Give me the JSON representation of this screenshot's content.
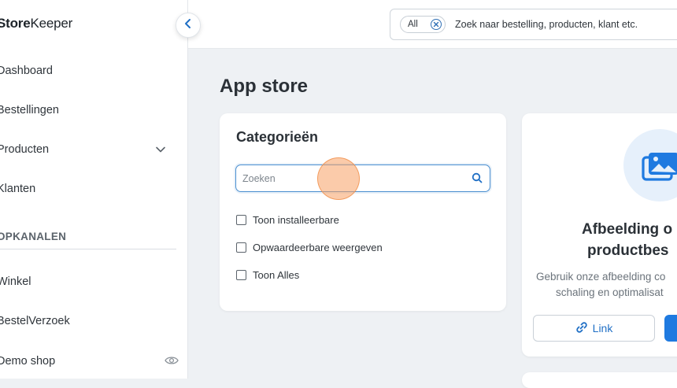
{
  "sidebar": {
    "logo_prefix": "Store",
    "logo_suffix": "Keeper",
    "items": [
      {
        "label": "Dashboard"
      },
      {
        "label": "Bestellingen"
      },
      {
        "label": "Producten"
      },
      {
        "label": "Klanten"
      }
    ],
    "section_title": "VERKOOPKANALEN",
    "section_title_visible": "OPKANALEN",
    "channels": [
      {
        "label": "Winkel"
      },
      {
        "label": "BestelVerzoek"
      },
      {
        "label": "Demo shop"
      }
    ]
  },
  "topbar": {
    "scope_label": "All",
    "search_text": "Zoek naar bestelling, producten, klant etc."
  },
  "page": {
    "title": "App store"
  },
  "categories": {
    "title": "Categorieën",
    "search_placeholder": "Zoeken",
    "search_value": "",
    "filters": [
      {
        "label": "Toon installeerbare",
        "checked": false
      },
      {
        "label": "Opwaardeerbare weergeven",
        "checked": false
      },
      {
        "label": "Toon Alles",
        "checked": false
      }
    ]
  },
  "app_card": {
    "title_line1": "Afbeelding o",
    "title_line2": "productbes",
    "desc_line1": "Gebruik onze afbeelding co",
    "desc_line2": "schaling en optimalisat",
    "link_label": "Link"
  },
  "colors": {
    "accent": "#1f7ae0",
    "link": "#1f6fc5",
    "background": "#eef1f4",
    "focus_ring": "#4a8fd0"
  }
}
